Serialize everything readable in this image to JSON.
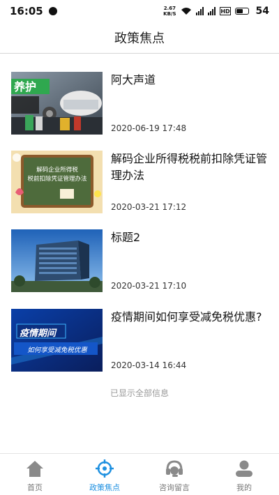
{
  "status_bar": {
    "time": "16:05",
    "net_speed_top": "2.67",
    "net_speed_unit": "KB/S",
    "battery": "54"
  },
  "header": {
    "title": "政策焦点"
  },
  "articles": [
    {
      "title": "阿大声道",
      "date": "2020-06-19 17:48",
      "thumb_icon": "car-banner-image"
    },
    {
      "title": "解码企业所得税税前扣除凭证管理办法",
      "date": "2020-03-21 17:12",
      "thumb_icon": "chalkboard-image",
      "thumb_text_1": "解码企业所得税",
      "thumb_text_2": "税前扣除凭证管理办法"
    },
    {
      "title": "标题2",
      "date": "2020-03-21 17:10",
      "thumb_icon": "office-building-image"
    },
    {
      "title": "疫情期间如何享受减免税优惠?",
      "date": "2020-03-14 16:44",
      "thumb_icon": "epidemic-banner-image",
      "thumb_text_1": "疫情期间",
      "thumb_text_2": "如何享受减免税优惠"
    }
  ],
  "end_note": "已显示全部信息",
  "tabs": [
    {
      "label": "首页",
      "icon": "home-icon"
    },
    {
      "label": "政策焦点",
      "icon": "target-icon",
      "active": true
    },
    {
      "label": "咨询留言",
      "icon": "headset-icon"
    },
    {
      "label": "我的",
      "icon": "user-icon"
    }
  ],
  "accent_color": "#1e90e0"
}
